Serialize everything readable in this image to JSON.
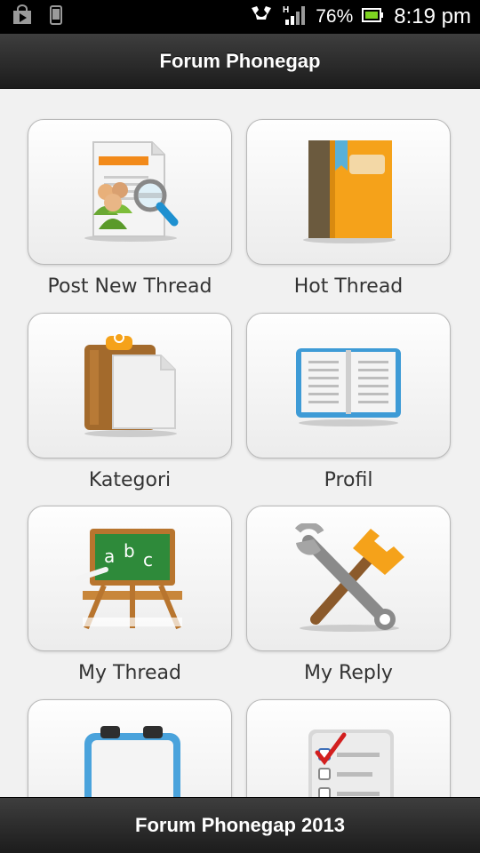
{
  "status_bar": {
    "battery": "76%",
    "time": "8:19 pm",
    "icons": [
      "play-store-notification-icon",
      "phone-notification-icon",
      "alarm-icon",
      "signal-h-icon",
      "battery-icon"
    ]
  },
  "header": {
    "title": "Forum Phonegap"
  },
  "menu": {
    "items": [
      {
        "label": "Post New Thread",
        "icon": "post-thread-icon"
      },
      {
        "label": "Hot Thread",
        "icon": "book-icon"
      },
      {
        "label": "Kategori",
        "icon": "clipboard-icon"
      },
      {
        "label": "Profil",
        "icon": "open-book-icon"
      },
      {
        "label": "My Thread",
        "icon": "chalkboard-icon"
      },
      {
        "label": "My Reply",
        "icon": "tools-icon"
      },
      {
        "label": "",
        "icon": "whiteboard-icon"
      },
      {
        "label": "",
        "icon": "checklist-icon"
      }
    ]
  },
  "footer": {
    "text": "Forum Phonegap 2013"
  },
  "colors": {
    "bar_dark": "#1c1c1c",
    "background": "#f1f1f1",
    "label": "#333333"
  }
}
